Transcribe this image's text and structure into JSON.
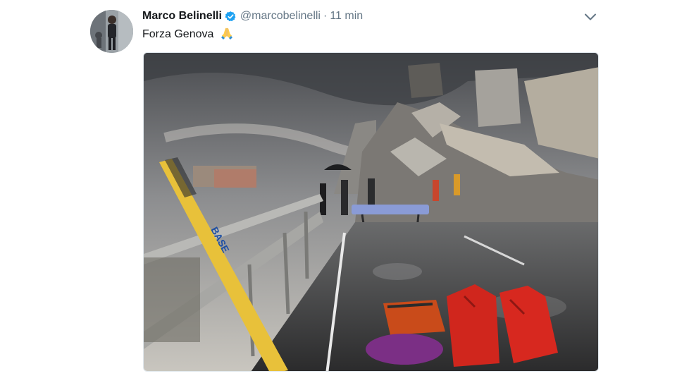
{
  "tweet": {
    "author_name": "Marco Belinelli",
    "handle": "@marcobelinelli",
    "separator": "·",
    "timestamp": "11 min",
    "text": "Forza Genova",
    "emoji": "🙏",
    "verified": true
  },
  "icons": {
    "verified": "verified-badge-icon",
    "more": "chevron-down-icon",
    "emoji": "folded-hands-emoji"
  },
  "colors": {
    "text": "#14171a",
    "secondary": "#657786",
    "verified": "#1da1f2"
  }
}
